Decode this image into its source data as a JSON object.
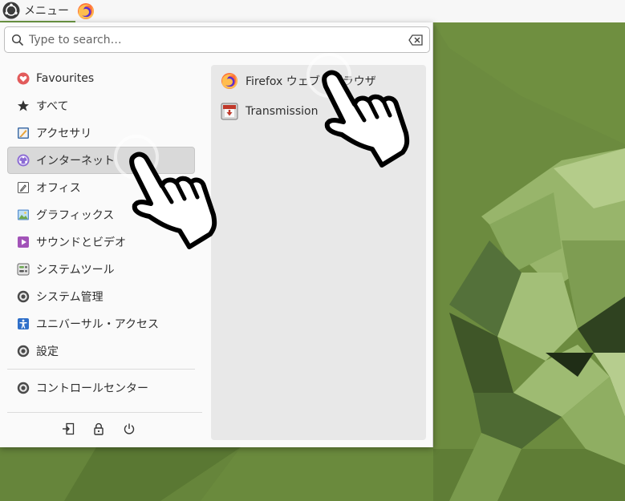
{
  "panel": {
    "menu_label": "メニュー"
  },
  "search": {
    "placeholder": "Type to search…"
  },
  "categories": [
    {
      "label": "Favourites",
      "icon": "heart-icon",
      "selected": false
    },
    {
      "label": "すべて",
      "icon": "star-icon",
      "selected": false
    },
    {
      "label": "アクセサリ",
      "icon": "accessories-icon",
      "selected": false
    },
    {
      "label": "インターネット",
      "icon": "internet-icon",
      "selected": true
    },
    {
      "label": "オフィス",
      "icon": "office-icon",
      "selected": false
    },
    {
      "label": "グラフィックス",
      "icon": "graphics-icon",
      "selected": false
    },
    {
      "label": "サウンドとビデオ",
      "icon": "multimedia-icon",
      "selected": false
    },
    {
      "label": "システムツール",
      "icon": "system-tools-icon",
      "selected": false
    },
    {
      "label": "システム管理",
      "icon": "gear-icon",
      "selected": false
    },
    {
      "label": "ユニバーサル・アクセス",
      "icon": "accessibility-icon",
      "selected": false
    },
    {
      "label": "設定",
      "icon": "gear-icon",
      "selected": false
    }
  ],
  "control_center": {
    "label": "コントロールセンター",
    "icon": "gear-icon"
  },
  "apps": [
    {
      "label": "Firefox ウェブ・ブラウザ",
      "icon": "firefox-icon"
    },
    {
      "label": "Transmission",
      "icon": "transmission-icon"
    }
  ],
  "colors": {
    "accent": "#6f9a45",
    "selected_bg": "#d9d9d9",
    "apps_bg": "#e8e8e8"
  }
}
